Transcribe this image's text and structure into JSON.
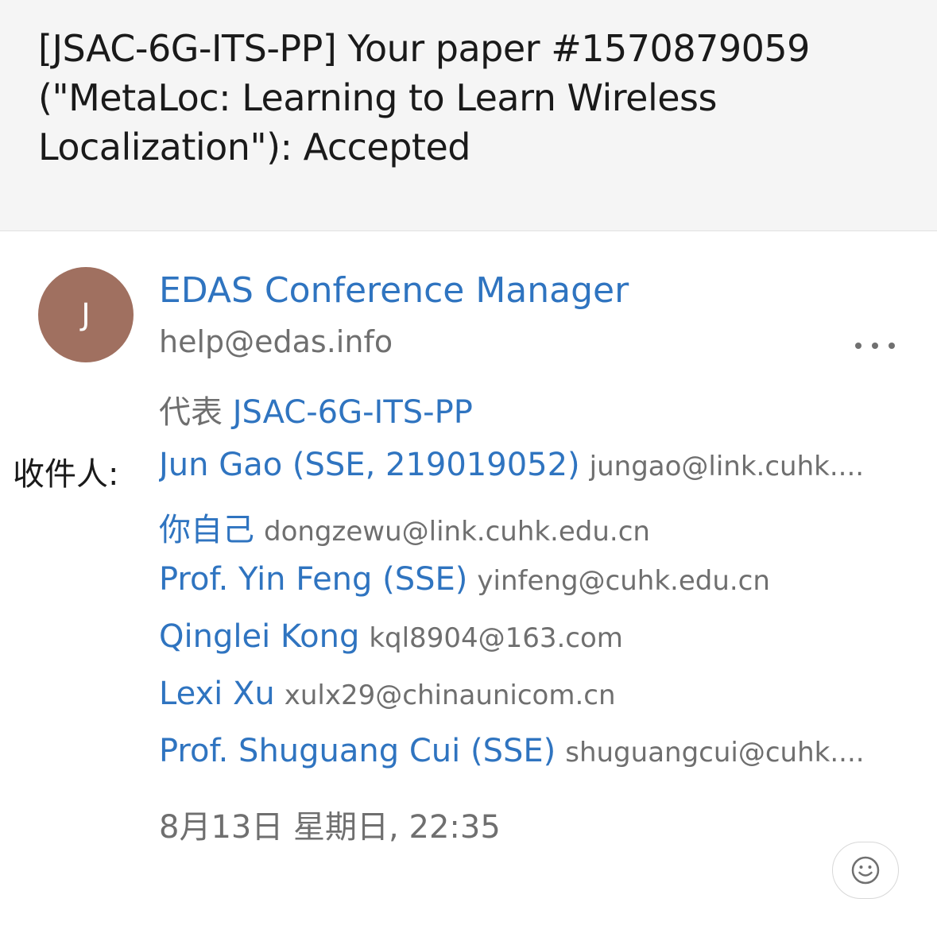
{
  "subject": "[JSAC-6G-ITS-PP] Your paper #1570879059 (\"MetaLoc: Learning to Learn Wireless Localization\"): Accepted",
  "sender": {
    "avatar_initial": "J",
    "avatar_color": "#a07060",
    "name": "EDAS Conference Manager",
    "email": "help@edas.info"
  },
  "on_behalf": {
    "prefix": "代表",
    "name": "JSAC-6G-ITS-PP"
  },
  "to_label": "收件人:",
  "recipients": [
    {
      "name": "Jun Gao (SSE, 219019052)",
      "email": "jungao@link.cuhk...."
    },
    {
      "name": "你自己",
      "email": "dongzewu@link.cuhk.edu.cn"
    },
    {
      "name": "Prof. Yin Feng (SSE)",
      "email": "yinfeng@cuhk.edu.cn"
    },
    {
      "name": "Qinglei Kong",
      "email": "kql8904@163.com"
    },
    {
      "name": "Lexi Xu",
      "email": "xulx29@chinaunicom.cn"
    },
    {
      "name": "Prof. Shuguang Cui (SSE)",
      "email": "shuguangcui@cuhk...."
    }
  ],
  "date": "8月13日 星期日, 22:35",
  "icons": {
    "more": "more-horizontal-icon",
    "reaction": "smiley-icon"
  },
  "colors": {
    "link_blue": "#2f74c0",
    "secondary_gray": "#6f6f6f",
    "header_bg": "#f5f5f5"
  }
}
